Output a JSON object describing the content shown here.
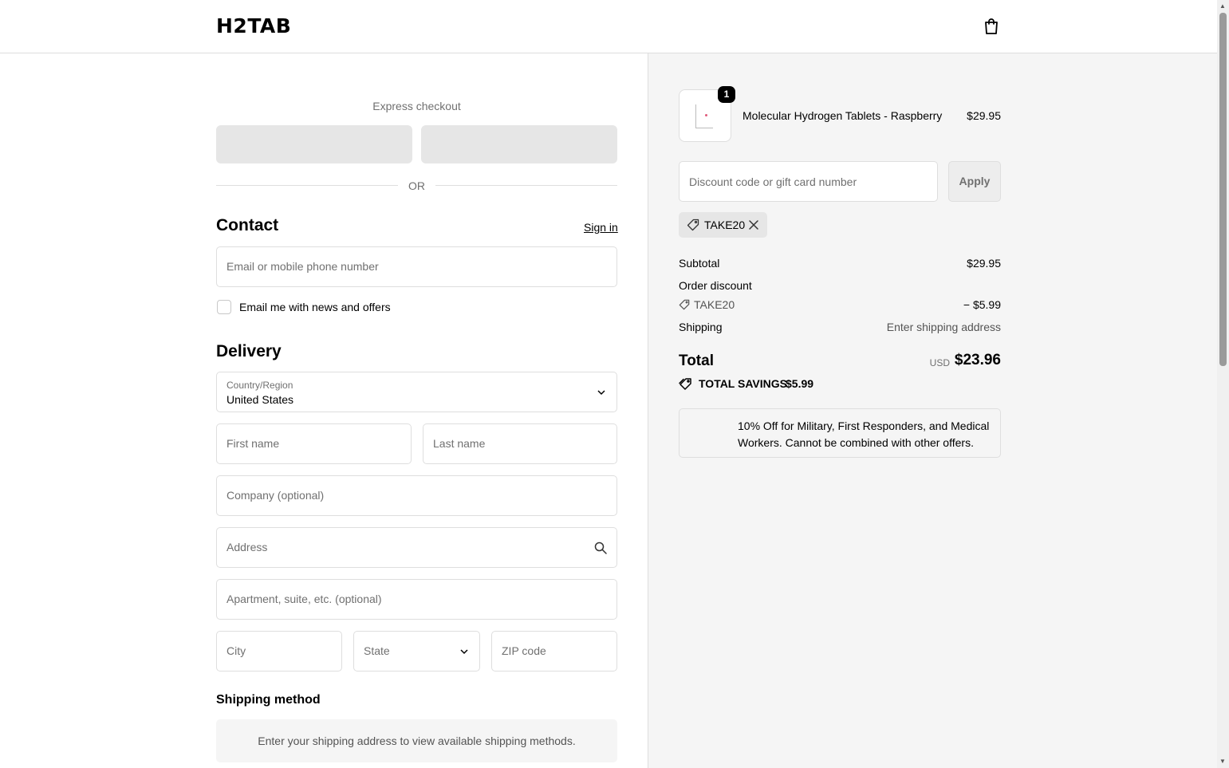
{
  "header": {
    "logo": "H2TAB",
    "cart_icon": "shopping-bag-icon"
  },
  "express": {
    "title": "Express checkout",
    "or": "OR"
  },
  "contact": {
    "title": "Contact",
    "signin": "Sign in",
    "email_placeholder": "Email or mobile phone number",
    "news_label": "Email me with news and offers"
  },
  "delivery": {
    "title": "Delivery",
    "country_label": "Country/Region",
    "country_value": "United States",
    "first_name": "First name",
    "last_name": "Last name",
    "company": "Company (optional)",
    "address": "Address",
    "apartment": "Apartment, suite, etc. (optional)",
    "city": "City",
    "state": "State",
    "zip": "ZIP code"
  },
  "shipping": {
    "title": "Shipping method",
    "message": "Enter your shipping address to view available shipping methods."
  },
  "summary": {
    "product": {
      "name": "Molecular Hydrogen Tablets - Raspberry",
      "price": "$29.95",
      "quantity": "1"
    },
    "discount_placeholder": "Discount code or gift card number",
    "apply": "Apply",
    "applied_code": "TAKE20",
    "subtotal_label": "Subtotal",
    "subtotal_value": "$29.95",
    "order_discount_label": "Order discount",
    "discount_code": "TAKE20",
    "discount_value": "− $5.99",
    "shipping_label": "Shipping",
    "shipping_value": "Enter shipping address",
    "total_label": "Total",
    "currency": "USD",
    "total_value": "$23.96",
    "savings_label": "TOTAL SAVINGS",
    "savings_value": "$5.99",
    "promo_text": "10% Off for Military, First Responders, and Medical Workers. Cannot be combined with other offers."
  }
}
